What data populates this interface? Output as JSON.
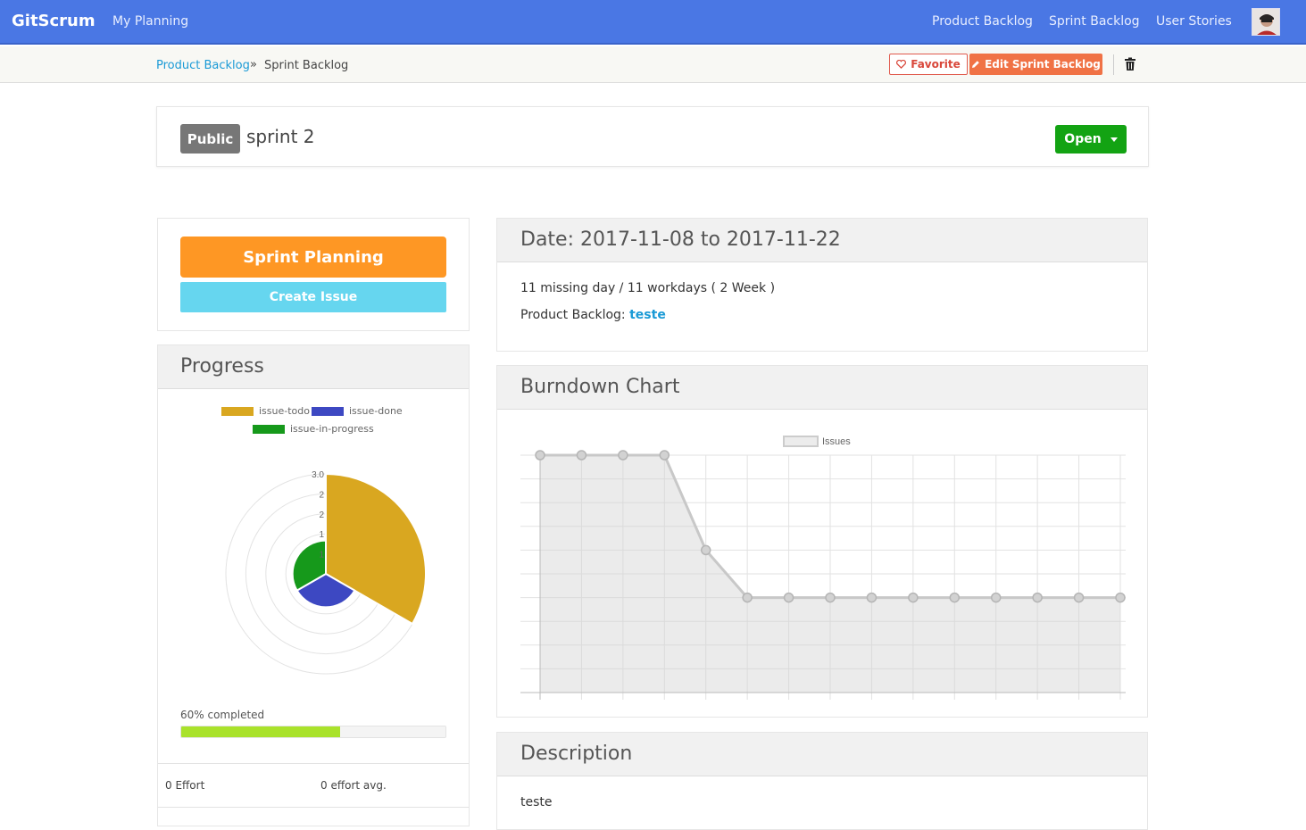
{
  "navbar": {
    "brand": "GitScrum",
    "my_planning": "My Planning",
    "links": [
      "Product Backlog",
      "Sprint Backlog",
      "User Stories"
    ]
  },
  "breadcrumb": {
    "parent": "Product Backlog",
    "separator": "»",
    "current": "Sprint Backlog"
  },
  "toolbar": {
    "favorite_label": "Favorite",
    "edit_label": "Edit Sprint Backlog",
    "icons": [
      "heart-icon",
      "pencil-icon",
      "trash-icon"
    ]
  },
  "sprint": {
    "visibility": "Public",
    "name": "sprint 2",
    "status": "Open"
  },
  "actions": {
    "sprint_planning": "Sprint Planning",
    "create_issue": "Create Issue"
  },
  "progress": {
    "title": "Progress",
    "legend": [
      {
        "name": "issue-todo",
        "color": "#d9a720"
      },
      {
        "name": "issue-done",
        "color": "#3d48c2"
      },
      {
        "name": "issue-in-progress",
        "color": "#16991b"
      }
    ],
    "completed_label": "60% completed",
    "completed_fraction": 0.6,
    "effort": "0 Effort",
    "effort_avg": "0 effort avg."
  },
  "details": {
    "title": "Date: 2017-11-08 to 2017-11-22",
    "days": "11 missing day / 11 workdays ( 2 Week )",
    "backlog_label": "Product Backlog:",
    "backlog_link": "teste"
  },
  "burndown": {
    "title": "Burndown Chart"
  },
  "description": {
    "title": "Description",
    "text": "teste"
  },
  "chart_data": [
    {
      "type": "polar-area",
      "series": [
        {
          "name": "issue-todo",
          "value": 3,
          "color": "#d9a720"
        },
        {
          "name": "issue-done",
          "value": 1,
          "color": "#3d48c2"
        },
        {
          "name": "issue-in-progress",
          "value": 1,
          "color": "#16991b"
        }
      ],
      "tick_labels": [
        "3.0",
        "2",
        "2",
        "1",
        "1"
      ],
      "rmax": 3
    },
    {
      "type": "line",
      "series": [
        {
          "name": "Issues",
          "color": "#c8c8c8",
          "values": [
            5,
            5,
            5,
            5,
            3,
            2,
            2,
            2,
            2,
            2,
            2,
            2,
            2,
            2,
            2
          ]
        }
      ],
      "ylim": [
        0,
        5
      ],
      "grid": true,
      "legend": "top"
    }
  ]
}
